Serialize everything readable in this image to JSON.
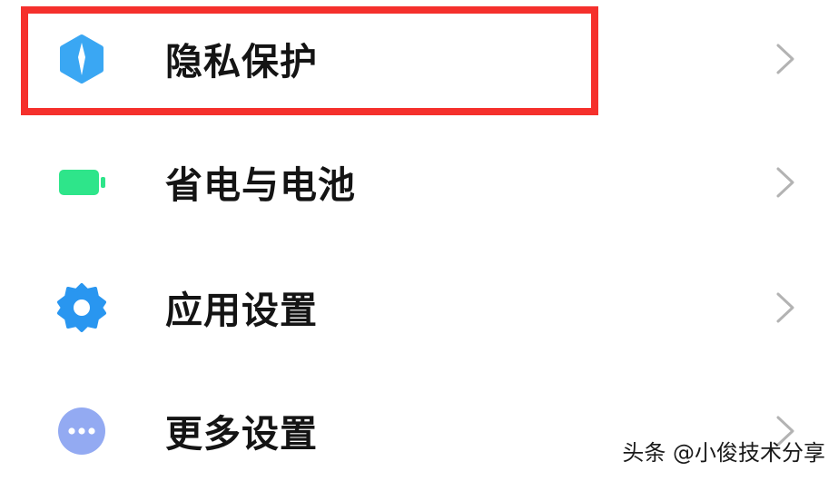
{
  "settings": {
    "items": [
      {
        "label": "隐私保护",
        "icon": "privacy-shield-icon",
        "icon_color": "#3aa7f3"
      },
      {
        "label": "省电与电池",
        "icon": "battery-icon",
        "icon_color": "#2ee58a"
      },
      {
        "label": "应用设置",
        "icon": "gear-icon",
        "icon_color": "#2996f0"
      },
      {
        "label": "更多设置",
        "icon": "more-dots-icon",
        "icon_color": "#93aaf2"
      }
    ]
  },
  "highlight": {
    "color": "#f5302c",
    "target": "隐私保护"
  },
  "watermark": {
    "text": "头条 @小俊技术分享"
  }
}
